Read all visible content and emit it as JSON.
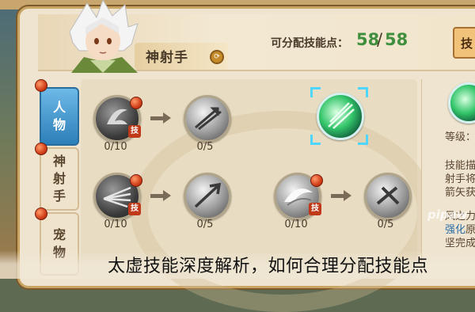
{
  "header": {
    "class_name": "神射手",
    "points_label": "可分配技能点：",
    "points_current": "58",
    "points_slash": "/",
    "points_max": "58",
    "button_label": "技"
  },
  "tabs": [
    {
      "label_lines": [
        "人",
        "物"
      ],
      "active": true
    },
    {
      "label_lines": [
        "神",
        "射",
        "手"
      ],
      "active": false
    },
    {
      "label_lines": [
        "宠",
        "物"
      ],
      "active": false
    }
  ],
  "skills": [
    {
      "level": "0/10",
      "badge": "技"
    },
    {
      "level": "0/5"
    },
    {
      "level": "0/10",
      "badge": "技"
    },
    {
      "level": "0/5"
    },
    {
      "level": "0/10",
      "badge": "技"
    },
    {
      "level": "0/5"
    }
  ],
  "info": {
    "level_label": "等级：",
    "desc_title": "技能描",
    "desc_line1": "射手将",
    "desc_line2": "箭矢获",
    "wind_line1": "风之力",
    "wind_line2_prefix": "强化",
    "wind_line2_rest": "原",
    "wind_line3": "坚完成"
  },
  "caption": "太虚技能深度解析，如何合理分配技能点",
  "watermark": "pipaw",
  "colors": {
    "accent_green": "#3f8f3f",
    "tab_active": "#2d7fb9",
    "frame_gold": "#caa463",
    "badge_red": "#c03a1a"
  }
}
